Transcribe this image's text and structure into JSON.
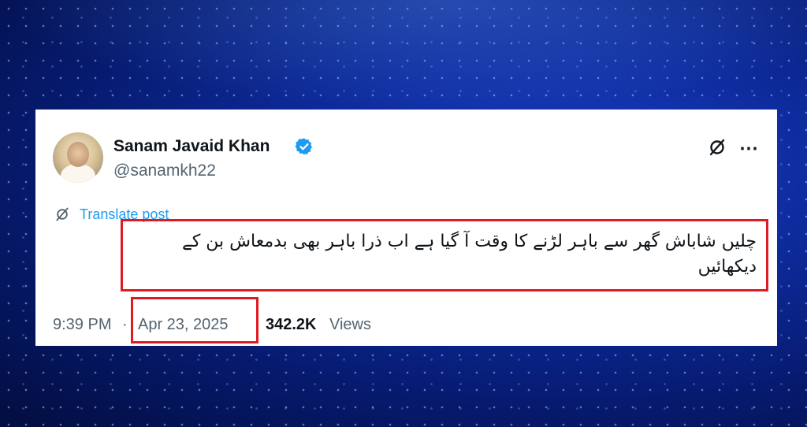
{
  "post": {
    "author_name": "Sanam Javaid Khan",
    "handle": "@sanamkh22",
    "translate_label": "Translate post",
    "text": "چلیں شاباش گھر سے باہر لڑنے کا وقت آ گیا ہے اب ذرا باہر بھی بدمعاش بن کے دیکھائیں",
    "time": "9:39 PM",
    "separator": "·",
    "date": "Apr 23, 2025",
    "views_count": "342.2K",
    "views_label": "Views"
  },
  "icons": {
    "verified": "verified-badge-icon",
    "grok": "grok-icon",
    "more": "more-options-icon",
    "translate": "translate-icon"
  },
  "colors": {
    "highlight_box": "#e01a22",
    "link": "#1d9bf0",
    "verified": "#1d9bf0"
  }
}
